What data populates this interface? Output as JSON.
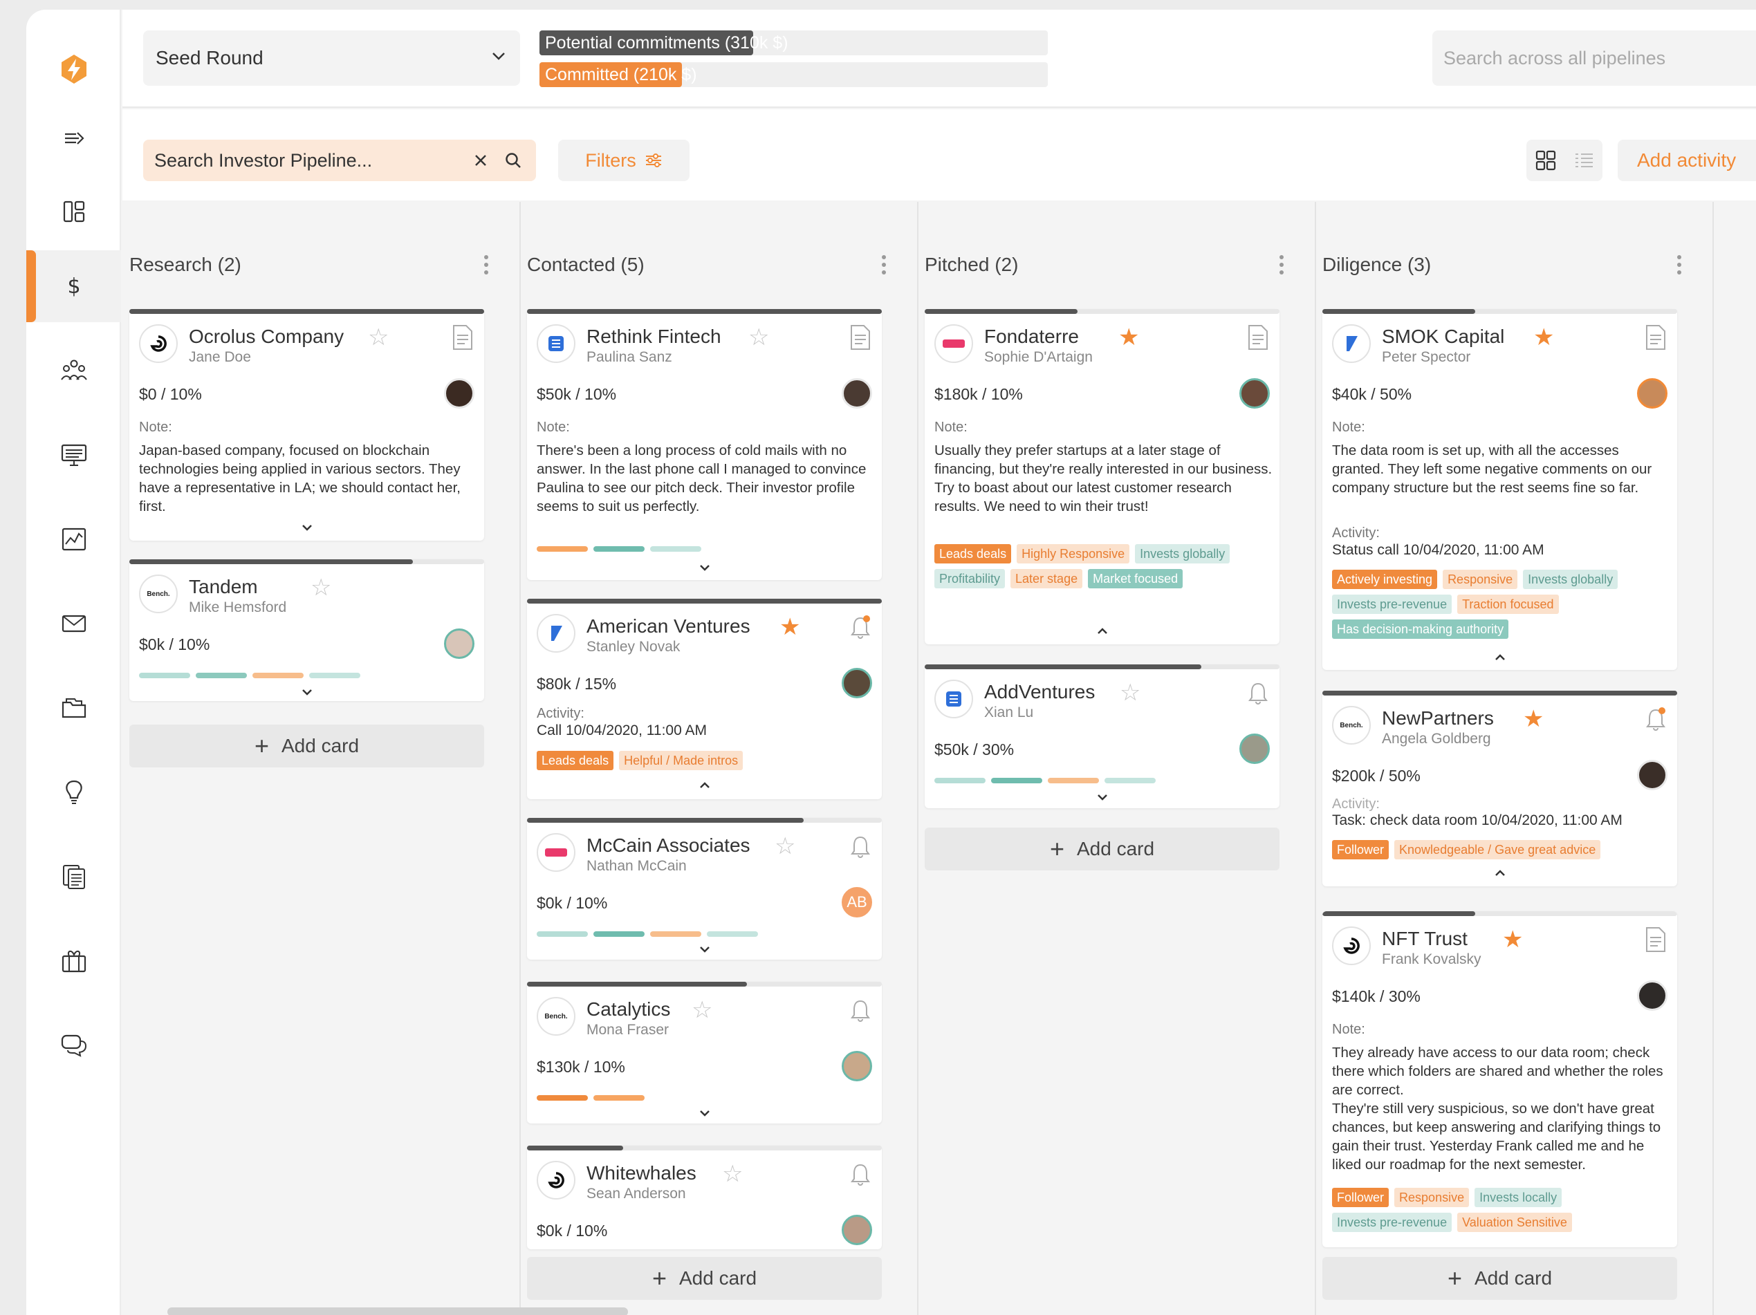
{
  "topbar": {
    "round": "Seed Round",
    "potential_label": "Potential commitments (310k $)",
    "potential_fraction": 0.42,
    "committed_label": "Committed (210k $)",
    "committed_fraction": 0.28,
    "global_search_placeholder": "Search across all pipelines"
  },
  "toolbar": {
    "pipeline_search_value": "Search Investor Pipeline...",
    "filters_label": "Filters",
    "add_activity_label": "Add activity"
  },
  "sidebar": {
    "items": [
      {
        "icon": "logo-bolt-icon"
      },
      {
        "icon": "expand-arrow-icon"
      },
      {
        "icon": "dashboard-icon"
      },
      {
        "icon": "dollar-icon",
        "active": true
      },
      {
        "icon": "team-icon"
      },
      {
        "icon": "presentation-icon"
      },
      {
        "icon": "chart-icon"
      },
      {
        "icon": "mail-icon"
      },
      {
        "icon": "folder-icon"
      },
      {
        "icon": "lightbulb-icon"
      },
      {
        "icon": "documents-icon"
      },
      {
        "icon": "gift-icon"
      },
      {
        "icon": "chat-icon"
      }
    ]
  },
  "colors": {
    "accent": "#f28a36",
    "teal": "#8cc9bd",
    "dark_bar": "#555555"
  },
  "add_card_label": "Add card",
  "note_label": "Note:",
  "activity_label": "Activity:",
  "columns": [
    {
      "name": "Research",
      "count": "(2)",
      "cards": [
        {
          "title": "Ocrolus Company",
          "contact": "Jane Doe",
          "amount": "$0 / 10%",
          "starred": false,
          "note": "Japan-based company, focused on blockchain technologies being applied in various sectors. They have a representative in LA; we should contact  her, first."
        },
        {
          "title": "Tandem",
          "contact": "Mike Hemsford",
          "amount": "$0k / 10%",
          "starred": false,
          "logo_text": "Bench."
        }
      ]
    },
    {
      "name": "Contacted",
      "count": "(5)",
      "cards": [
        {
          "title": "Rethink Fintech",
          "contact": "Paulina Sanz",
          "amount": "$50k / 10%",
          "starred": false,
          "note": "There's been a long process of cold mails with no answer. In the last phone call I managed to convince Paulina to see our pitch deck. Their investor profile seems to suit us perfectly."
        },
        {
          "title": "American Ventures",
          "contact": "Stanley Novak",
          "amount": "$80k / 15%",
          "starred": true,
          "activity": "Call 10/04/2020, 11:00 AM",
          "tags": [
            "Leads deals",
            "Helpful / Made intros"
          ]
        },
        {
          "title": "McCain Associates",
          "contact": "Nathan McCain",
          "amount": "$0k / 10%",
          "starred": false,
          "avatar_text": "AB"
        },
        {
          "title": "Catalytics",
          "contact": "Mona Fraser",
          "amount": "$130k / 10%",
          "starred": false,
          "logo_text": "Bench."
        },
        {
          "title": "Whitewhales",
          "contact": "Sean Anderson",
          "amount": "$0k / 10%",
          "starred": false
        }
      ]
    },
    {
      "name": "Pitched",
      "count": "(2)",
      "cards": [
        {
          "title": "Fondaterre",
          "contact": "Sophie D'Artaign",
          "amount": "$180k / 10%",
          "starred": true,
          "note": "Usually they prefer startups at a later stage of financing, but they're really interested in our business. Try to boast about our latest customer research results. We need to win their trust!",
          "tags": [
            "Leads deals",
            "Highly Responsive",
            "Invests globally",
            "Profitability",
            "Later stage",
            "Market focused"
          ]
        },
        {
          "title": "AddVentures",
          "contact": "Xian Lu",
          "amount": "$50k / 30%",
          "starred": false
        }
      ]
    },
    {
      "name": "Diligence",
      "count": "(3)",
      "cards": [
        {
          "title": "SMOK Capital",
          "contact": "Peter Spector",
          "amount": "$40k / 50%",
          "starred": true,
          "note": "The data room is set up, with all the accesses granted. They left some negative comments on our company structure but the rest seems fine so far.",
          "activity": "Status call 10/04/2020, 11:00 AM",
          "tags": [
            "Actively investing",
            "Responsive",
            "Invests globally",
            "Invests pre-revenue",
            "Traction focused",
            "Has decision-making authority"
          ]
        },
        {
          "title": "NewPartners",
          "contact": "Angela Goldberg",
          "amount": "$200k / 50%",
          "starred": true,
          "logo_text": "Bench.",
          "activity": "Task: check data room 10/04/2020, 11:00 AM",
          "tags": [
            "Follower",
            "Knowledgeable / Gave great advice"
          ]
        },
        {
          "title": "NFT Trust",
          "contact": "Frank Kovalsky",
          "amount": "$140k / 30%",
          "starred": true,
          "note": "They already have access to our data room; check there which folders are shared and whether the roles are correct.\nThey're still very suspicious, so we don't have great chances, but keep answering and clarifying things to gain their trust. Yesterday Frank called me and he liked our roadmap for the next semester.",
          "tags": [
            "Follower",
            "Responsive",
            "Invests locally",
            "Invests pre-revenue",
            "Valuation Sensitive"
          ]
        }
      ]
    }
  ]
}
